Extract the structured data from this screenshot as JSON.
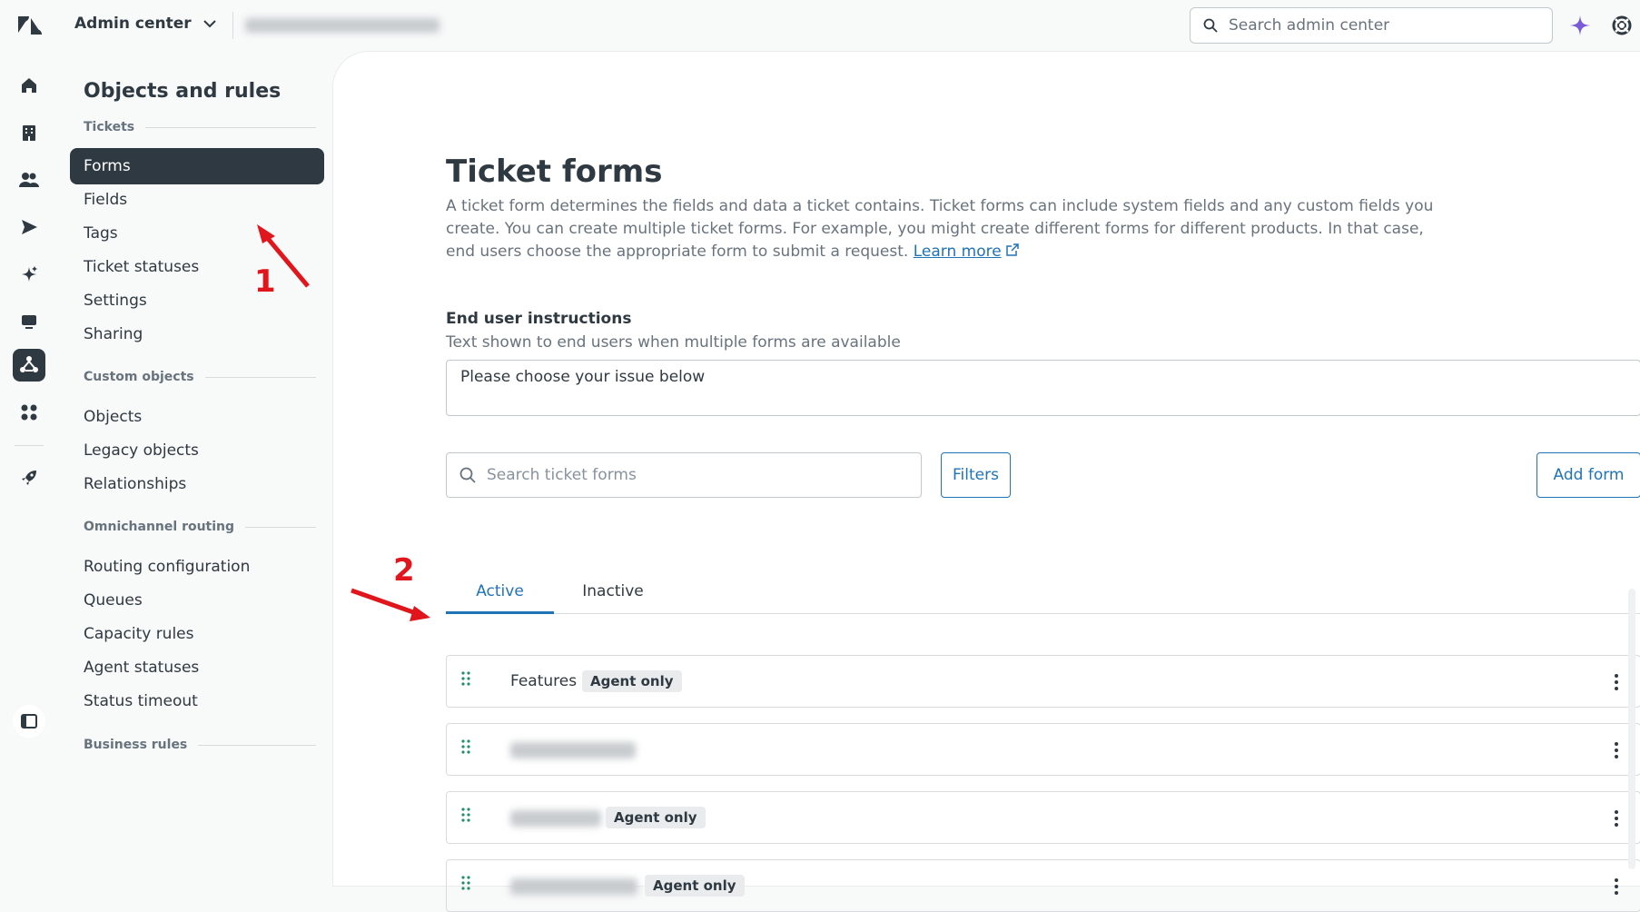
{
  "header": {
    "product_label": "Admin center",
    "search_placeholder": "Search admin center"
  },
  "rail": {
    "icons": [
      "home-icon",
      "building-icon",
      "people-icon",
      "send-icon",
      "sparkle-icon",
      "monitor-icon",
      "objects-rules-icon",
      "apps-icon",
      "rocket-icon",
      "sidebar-toggle-icon"
    ],
    "active": "objects-rules-icon"
  },
  "subnav": {
    "title": "Objects and rules",
    "sections": {
      "tickets": "Tickets",
      "custom_objects": "Custom objects",
      "omnichannel": "Omnichannel routing",
      "business_rules": "Business rules"
    },
    "items": {
      "forms": "Forms",
      "fields": "Fields",
      "tags": "Tags",
      "ticket_statuses": "Ticket statuses",
      "settings": "Settings",
      "sharing": "Sharing",
      "objects": "Objects",
      "legacy_objects": "Legacy objects",
      "relationships": "Relationships",
      "routing_configuration": "Routing configuration",
      "queues": "Queues",
      "capacity_rules": "Capacity rules",
      "agent_statuses": "Agent statuses",
      "status_timeout": "Status timeout"
    },
    "active_item": "Forms"
  },
  "page": {
    "title": "Ticket forms",
    "description_line1": "A ticket form determines the fields and data a ticket contains. Ticket forms can include system fields and any custom fields you create. You can create multiple ticket forms. For example, you might create different forms for different products. In that case, end users choose the appropriate form to submit a request.",
    "learn_more": "Learn more",
    "instructions_label": "End user instructions",
    "instructions_hint": "Text shown to end users when multiple forms are available",
    "instructions_value": "Please choose your issue below",
    "search_placeholder": "Search ticket forms",
    "filters_label": "Filters",
    "add_form_label": "Add form",
    "tabs": {
      "active": "Active",
      "inactive": "Inactive"
    },
    "active_tab": "Active",
    "forms": [
      {
        "name": "Features",
        "badge": "Agent only",
        "name_redacted": false
      },
      {
        "name": "",
        "badge": "",
        "name_redacted": true
      },
      {
        "name": "",
        "badge": "Agent only",
        "name_redacted": true
      },
      {
        "name": "",
        "badge": "Agent only",
        "name_redacted": true
      }
    ]
  },
  "annotations": {
    "step1": "1",
    "step2": "2"
  },
  "colors": {
    "accent": "#1f73b7",
    "nav_active": "#2f3941",
    "annotation": "#e0161c",
    "ai_sparkle": "#7b5cd6",
    "grip": "#228f67"
  }
}
